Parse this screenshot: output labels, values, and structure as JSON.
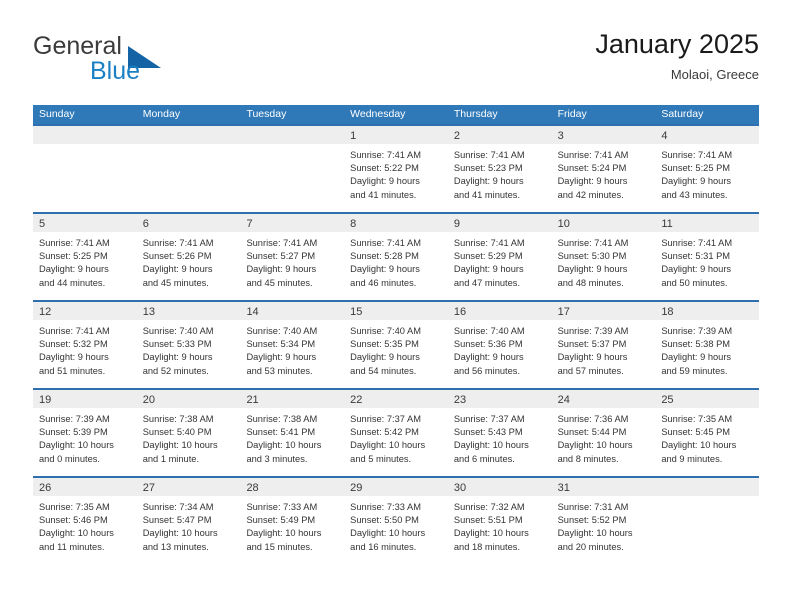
{
  "brand": {
    "word_one": "General",
    "word_two": "Blue",
    "logo_icon": "triangle-logo-icon",
    "accent_color": "#1464a5",
    "blue_text_color": "#1b7fc4"
  },
  "header": {
    "title": "January 2025",
    "subtitle": "Molaoi, Greece"
  },
  "theme": {
    "header_bg": "#3079b8",
    "row_divider": "#2f6fad",
    "date_band_bg": "#eeeeee"
  },
  "calendar": {
    "day_names": [
      "Sunday",
      "Monday",
      "Tuesday",
      "Wednesday",
      "Thursday",
      "Friday",
      "Saturday"
    ],
    "weeks": [
      [
        {
          "date": "",
          "lines": []
        },
        {
          "date": "",
          "lines": []
        },
        {
          "date": "",
          "lines": []
        },
        {
          "date": "1",
          "lines": [
            "Sunrise: 7:41 AM",
            "Sunset: 5:22 PM",
            "Daylight: 9 hours",
            "and 41 minutes."
          ]
        },
        {
          "date": "2",
          "lines": [
            "Sunrise: 7:41 AM",
            "Sunset: 5:23 PM",
            "Daylight: 9 hours",
            "and 41 minutes."
          ]
        },
        {
          "date": "3",
          "lines": [
            "Sunrise: 7:41 AM",
            "Sunset: 5:24 PM",
            "Daylight: 9 hours",
            "and 42 minutes."
          ]
        },
        {
          "date": "4",
          "lines": [
            "Sunrise: 7:41 AM",
            "Sunset: 5:25 PM",
            "Daylight: 9 hours",
            "and 43 minutes."
          ]
        }
      ],
      [
        {
          "date": "5",
          "lines": [
            "Sunrise: 7:41 AM",
            "Sunset: 5:25 PM",
            "Daylight: 9 hours",
            "and 44 minutes."
          ]
        },
        {
          "date": "6",
          "lines": [
            "Sunrise: 7:41 AM",
            "Sunset: 5:26 PM",
            "Daylight: 9 hours",
            "and 45 minutes."
          ]
        },
        {
          "date": "7",
          "lines": [
            "Sunrise: 7:41 AM",
            "Sunset: 5:27 PM",
            "Daylight: 9 hours",
            "and 45 minutes."
          ]
        },
        {
          "date": "8",
          "lines": [
            "Sunrise: 7:41 AM",
            "Sunset: 5:28 PM",
            "Daylight: 9 hours",
            "and 46 minutes."
          ]
        },
        {
          "date": "9",
          "lines": [
            "Sunrise: 7:41 AM",
            "Sunset: 5:29 PM",
            "Daylight: 9 hours",
            "and 47 minutes."
          ]
        },
        {
          "date": "10",
          "lines": [
            "Sunrise: 7:41 AM",
            "Sunset: 5:30 PM",
            "Daylight: 9 hours",
            "and 48 minutes."
          ]
        },
        {
          "date": "11",
          "lines": [
            "Sunrise: 7:41 AM",
            "Sunset: 5:31 PM",
            "Daylight: 9 hours",
            "and 50 minutes."
          ]
        }
      ],
      [
        {
          "date": "12",
          "lines": [
            "Sunrise: 7:41 AM",
            "Sunset: 5:32 PM",
            "Daylight: 9 hours",
            "and 51 minutes."
          ]
        },
        {
          "date": "13",
          "lines": [
            "Sunrise: 7:40 AM",
            "Sunset: 5:33 PM",
            "Daylight: 9 hours",
            "and 52 minutes."
          ]
        },
        {
          "date": "14",
          "lines": [
            "Sunrise: 7:40 AM",
            "Sunset: 5:34 PM",
            "Daylight: 9 hours",
            "and 53 minutes."
          ]
        },
        {
          "date": "15",
          "lines": [
            "Sunrise: 7:40 AM",
            "Sunset: 5:35 PM",
            "Daylight: 9 hours",
            "and 54 minutes."
          ]
        },
        {
          "date": "16",
          "lines": [
            "Sunrise: 7:40 AM",
            "Sunset: 5:36 PM",
            "Daylight: 9 hours",
            "and 56 minutes."
          ]
        },
        {
          "date": "17",
          "lines": [
            "Sunrise: 7:39 AM",
            "Sunset: 5:37 PM",
            "Daylight: 9 hours",
            "and 57 minutes."
          ]
        },
        {
          "date": "18",
          "lines": [
            "Sunrise: 7:39 AM",
            "Sunset: 5:38 PM",
            "Daylight: 9 hours",
            "and 59 minutes."
          ]
        }
      ],
      [
        {
          "date": "19",
          "lines": [
            "Sunrise: 7:39 AM",
            "Sunset: 5:39 PM",
            "Daylight: 10 hours",
            "and 0 minutes."
          ]
        },
        {
          "date": "20",
          "lines": [
            "Sunrise: 7:38 AM",
            "Sunset: 5:40 PM",
            "Daylight: 10 hours",
            "and 1 minute."
          ]
        },
        {
          "date": "21",
          "lines": [
            "Sunrise: 7:38 AM",
            "Sunset: 5:41 PM",
            "Daylight: 10 hours",
            "and 3 minutes."
          ]
        },
        {
          "date": "22",
          "lines": [
            "Sunrise: 7:37 AM",
            "Sunset: 5:42 PM",
            "Daylight: 10 hours",
            "and 5 minutes."
          ]
        },
        {
          "date": "23",
          "lines": [
            "Sunrise: 7:37 AM",
            "Sunset: 5:43 PM",
            "Daylight: 10 hours",
            "and 6 minutes."
          ]
        },
        {
          "date": "24",
          "lines": [
            "Sunrise: 7:36 AM",
            "Sunset: 5:44 PM",
            "Daylight: 10 hours",
            "and 8 minutes."
          ]
        },
        {
          "date": "25",
          "lines": [
            "Sunrise: 7:35 AM",
            "Sunset: 5:45 PM",
            "Daylight: 10 hours",
            "and 9 minutes."
          ]
        }
      ],
      [
        {
          "date": "26",
          "lines": [
            "Sunrise: 7:35 AM",
            "Sunset: 5:46 PM",
            "Daylight: 10 hours",
            "and 11 minutes."
          ]
        },
        {
          "date": "27",
          "lines": [
            "Sunrise: 7:34 AM",
            "Sunset: 5:47 PM",
            "Daylight: 10 hours",
            "and 13 minutes."
          ]
        },
        {
          "date": "28",
          "lines": [
            "Sunrise: 7:33 AM",
            "Sunset: 5:49 PM",
            "Daylight: 10 hours",
            "and 15 minutes."
          ]
        },
        {
          "date": "29",
          "lines": [
            "Sunrise: 7:33 AM",
            "Sunset: 5:50 PM",
            "Daylight: 10 hours",
            "and 16 minutes."
          ]
        },
        {
          "date": "30",
          "lines": [
            "Sunrise: 7:32 AM",
            "Sunset: 5:51 PM",
            "Daylight: 10 hours",
            "and 18 minutes."
          ]
        },
        {
          "date": "31",
          "lines": [
            "Sunrise: 7:31 AM",
            "Sunset: 5:52 PM",
            "Daylight: 10 hours",
            "and 20 minutes."
          ]
        },
        {
          "date": "",
          "lines": []
        }
      ]
    ]
  }
}
